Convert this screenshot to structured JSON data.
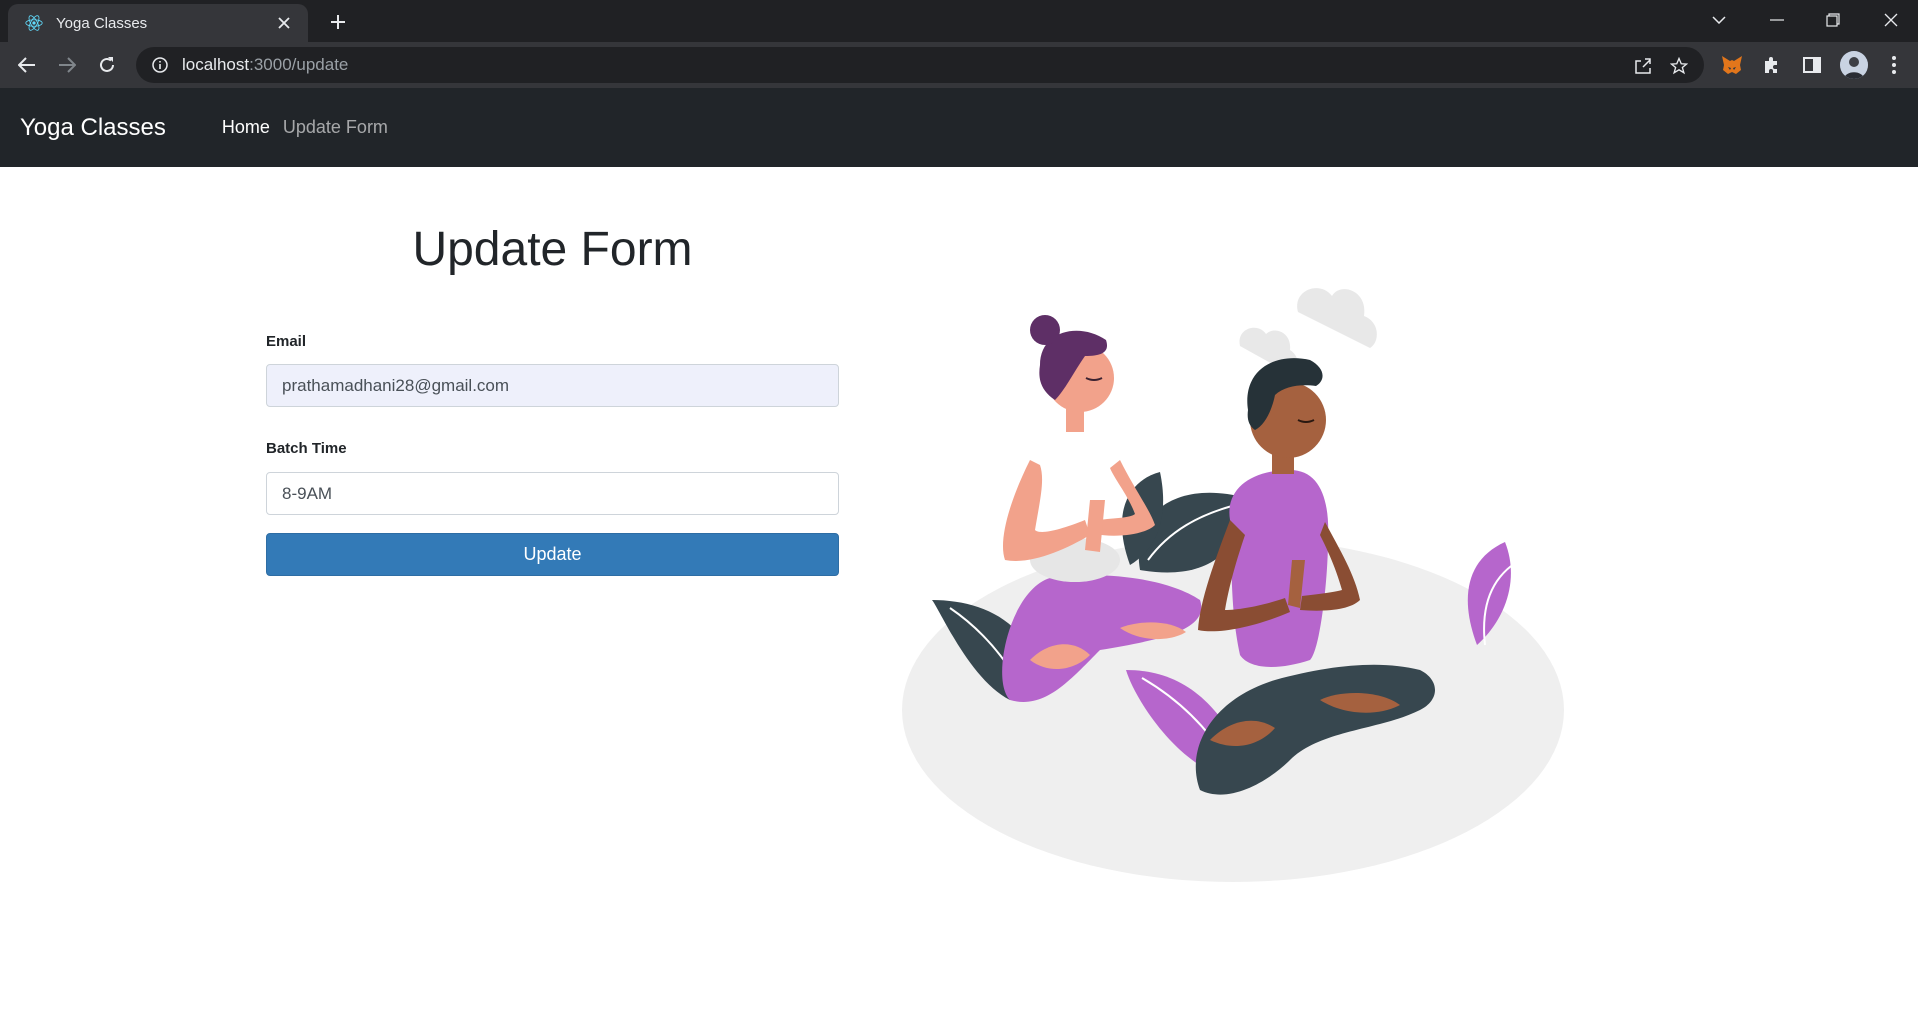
{
  "browser": {
    "tab": {
      "title": "Yoga Classes",
      "favicon": "react-icon"
    },
    "url": {
      "host": "localhost",
      "path": ":3000/update"
    }
  },
  "navbar": {
    "brand": "Yoga Classes",
    "links": [
      {
        "label": "Home",
        "active": true
      },
      {
        "label": "Update Form",
        "active": false
      }
    ]
  },
  "form": {
    "title": "Update Form",
    "email": {
      "label": "Email",
      "value": "prathamadhani28@gmail.com"
    },
    "batch": {
      "label": "Batch Time",
      "value": "8-9AM"
    },
    "submit_label": "Update"
  },
  "colors": {
    "navbar_bg": "#212529",
    "button_bg": "#337ab7",
    "accent_purple": "#b666cc",
    "leaf_dark": "#37474f"
  }
}
